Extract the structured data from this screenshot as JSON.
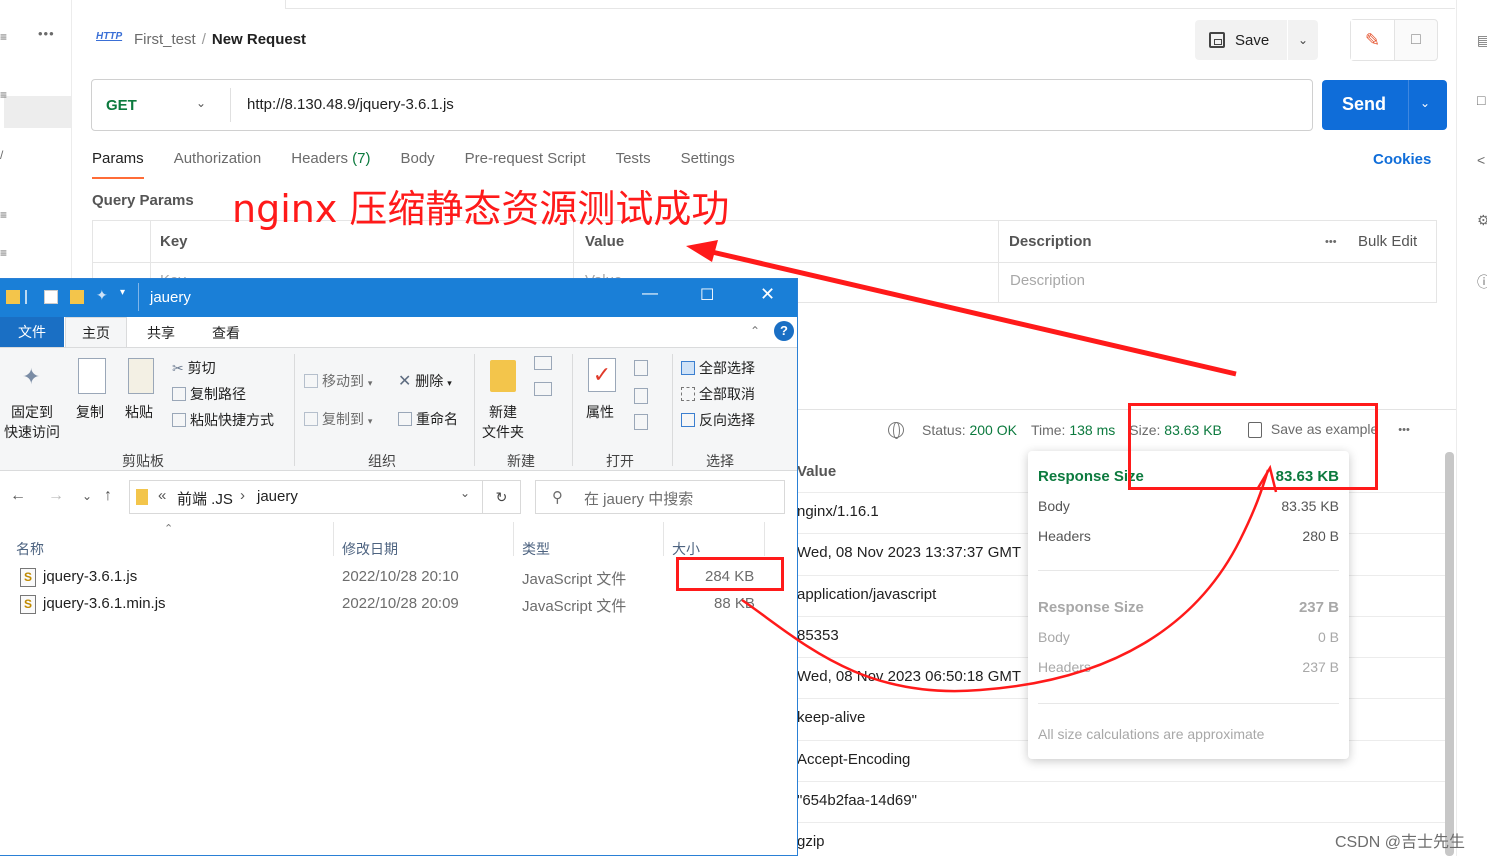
{
  "left_rail": {
    "dots": "•••"
  },
  "header": {
    "http_badge": "HTTP",
    "breadcrumb_parent": "First_test",
    "breadcrumb_sep": "/",
    "breadcrumb_current": "New Request",
    "save_label": "Save"
  },
  "request": {
    "method": "GET",
    "url": "http://8.130.48.9/jquery-3.6.1.js",
    "send_label": "Send",
    "tabs": [
      "Params",
      "Authorization",
      "Headers",
      "Body",
      "Pre-request Script",
      "Tests",
      "Settings"
    ],
    "headers_count": "(7)",
    "cookies_label": "Cookies",
    "query_params_label": "Query Params",
    "table": {
      "key_header": "Key",
      "value_header": "Value",
      "description_header": "Description",
      "bulk_edit": "Bulk Edit",
      "more": "•••",
      "key_placeholder": "Key",
      "value_placeholder": "Value",
      "description_placeholder": "Description"
    }
  },
  "annotation_text": "nginx 压缩静态资源测试成功",
  "response": {
    "status_label": "Status:",
    "status_value": "200 OK",
    "time_label": "Time:",
    "time_value": "138 ms",
    "size_label": "Size:",
    "size_value": "83.63 KB",
    "save_example": "Save as example",
    "more": "•••",
    "value_header": "Value",
    "header_values": [
      "nginx/1.16.1",
      "Wed, 08 Nov 2023 13:37:37 GMT",
      "application/javascript",
      "85353",
      "Wed, 08 Nov 2023 06:50:18 GMT",
      "keep-alive",
      "Accept-Encoding",
      "\"654b2faa-14d69\"",
      "gzip"
    ],
    "popover": {
      "response_size_title": "Response Size",
      "response_size_value": "83.63 KB",
      "body_label": "Body",
      "body_value": "83.35 KB",
      "headers_label": "Headers",
      "headers_value": "280 B",
      "request_size_title": "Response Size",
      "request_size_value": "237 B",
      "req_body_label": "Body",
      "req_body_value": "0 B",
      "req_headers_label": "Headers",
      "req_headers_value": "237 B",
      "footnote": "All size calculations are approximate"
    }
  },
  "explorer": {
    "title": "jauery",
    "menu": {
      "file": "文件",
      "home": "主页",
      "share": "共享",
      "view": "查看"
    },
    "ribbon": {
      "pin_quick": "固定到",
      "pin_quick2": "快速访问",
      "copy": "复制",
      "paste": "粘贴",
      "cut": "剪切",
      "copy_path": "复制路径",
      "paste_shortcut": "粘贴快捷方式",
      "move_to": "移动到",
      "copy_to": "复制到",
      "delete": "删除",
      "rename": "重命名",
      "new_folder": "新建",
      "new_folder2": "文件夹",
      "properties": "属性",
      "select_all": "全部选择",
      "select_none": "全部取消",
      "invert_select": "反向选择",
      "group_clipboard": "剪贴板",
      "group_organize": "组织",
      "group_new": "新建",
      "group_open": "打开",
      "group_select": "选择"
    },
    "address": {
      "prefix": "«",
      "parent": "前端 .JS",
      "current": "jauery"
    },
    "search_placeholder": "在 jauery 中搜索",
    "columns": {
      "name": "名称",
      "modified": "修改日期",
      "type": "类型",
      "size": "大小"
    },
    "files": [
      {
        "name": "jquery-3.6.1.js",
        "modified": "2022/10/28 20:10",
        "type": "JavaScript 文件",
        "size": "284 KB"
      },
      {
        "name": "jquery-3.6.1.min.js",
        "modified": "2022/10/28 20:09",
        "type": "JavaScript 文件",
        "size": "88 KB"
      }
    ]
  },
  "watermark": "CSDN @吉士先生",
  "colors": {
    "postman_send": "#0f6dd9",
    "status_green": "#0c7a3e",
    "annotation_red": "#ff1a1a",
    "explorer_blue": "#1a7fd7"
  }
}
